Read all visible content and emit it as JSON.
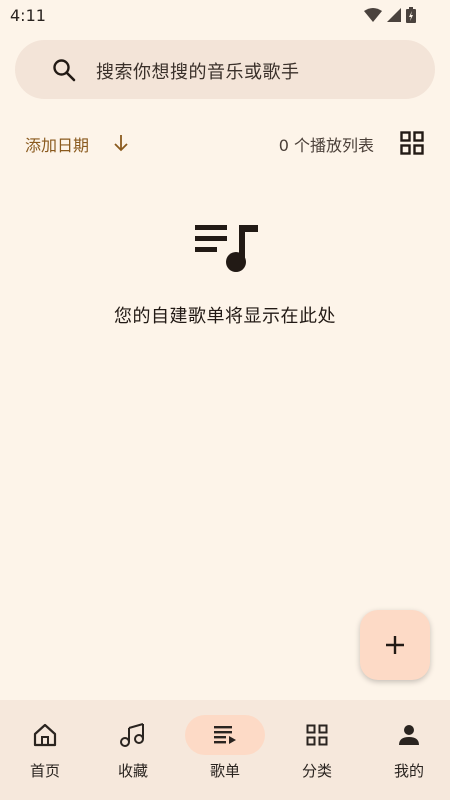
{
  "status_bar": {
    "time": "4:11",
    "icons": [
      "wifi-icon",
      "signal-icon",
      "battery-icon"
    ]
  },
  "search": {
    "placeholder": "搜索你想搜的音乐或歌手"
  },
  "sort": {
    "label": "添加日期",
    "direction": "descending"
  },
  "playlist_count_text": "0 个播放列表",
  "empty_state": {
    "icon": "playlist-music-icon",
    "message": "您的自建歌单将显示在此处"
  },
  "fab": {
    "icon": "plus-icon"
  },
  "bottom_nav": {
    "active_index": 2,
    "items": [
      {
        "label": "首页",
        "icon": "home-icon"
      },
      {
        "label": "收藏",
        "icon": "music-notes-icon"
      },
      {
        "label": "歌单",
        "icon": "playlist-icon"
      },
      {
        "label": "分类",
        "icon": "grid-icon"
      },
      {
        "label": "我的",
        "icon": "person-icon"
      }
    ]
  },
  "colors": {
    "background": "#fdf4e9",
    "search_bg": "#f3e4d8",
    "accent": "#8a5a1e",
    "fab_bg": "#fddac6",
    "nav_bg": "#f6e8dc",
    "active_pill": "#fddac6"
  }
}
